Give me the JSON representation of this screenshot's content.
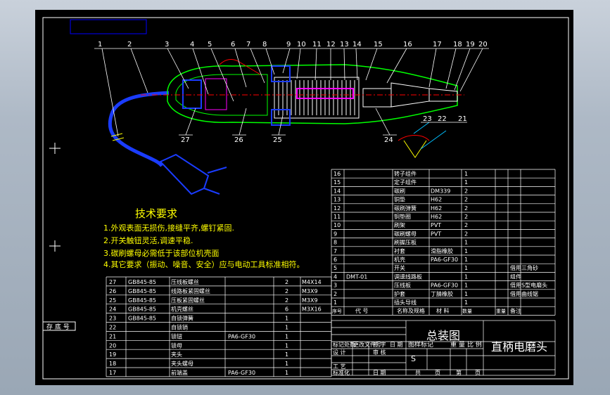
{
  "drawing": {
    "title": "直柄电磨头",
    "subtitle": "总装图",
    "stamp_label": "存 底 号"
  },
  "callouts_top": [
    "1",
    "2",
    "3",
    "4",
    "5",
    "6",
    "7",
    "8",
    "9",
    "10",
    "11",
    "12",
    "13",
    "14",
    "15",
    "16",
    "17",
    "18",
    "19",
    "20"
  ],
  "callouts_bottom": [
    "27",
    "26",
    "25",
    "24",
    "23",
    "22",
    "21"
  ],
  "requirements": {
    "heading": "技术要求",
    "items": [
      "1.外观表面无损伤,接缝平齐,螺钉紧固.",
      "2.开关触钮灵活,调速平稳.",
      "3.碳刷螺母必需低于该部位机壳面",
      "4.其它要求（振动、噪音、安全）应与电动工具标准相符。"
    ]
  },
  "bom_right": {
    "rows": [
      {
        "no": "16",
        "code": "",
        "name": "转子组件",
        "material": "",
        "qty": "1",
        "note": ""
      },
      {
        "no": "15",
        "code": "",
        "name": "定子组件",
        "material": "",
        "qty": "1",
        "note": ""
      },
      {
        "no": "14",
        "code": "",
        "name": "碳刷",
        "material": "DM339",
        "qty": "2",
        "note": ""
      },
      {
        "no": "13",
        "code": "",
        "name": "铜垫",
        "material": "H62",
        "qty": "2",
        "note": ""
      },
      {
        "no": "12",
        "code": "",
        "name": "碳刷弹簧",
        "material": "H62",
        "qty": "2",
        "note": ""
      },
      {
        "no": "11",
        "code": "",
        "name": "铜垫圈",
        "material": "H62",
        "qty": "2",
        "note": ""
      },
      {
        "no": "10",
        "code": "",
        "name": "刷架",
        "material": "PVT",
        "qty": "2",
        "note": ""
      },
      {
        "no": "9",
        "code": "",
        "name": "碳刷螺母",
        "material": "PVT",
        "qty": "2",
        "note": ""
      },
      {
        "no": "8",
        "code": "",
        "name": "刷握压板",
        "material": "",
        "qty": "1",
        "note": ""
      },
      {
        "no": "7",
        "code": "",
        "name": "衬套",
        "material": "滑脂橡胶",
        "qty": "1",
        "note": ""
      },
      {
        "no": "6",
        "code": "",
        "name": "机壳",
        "material": "PA6-GF30",
        "qty": "1",
        "note": ""
      },
      {
        "no": "5",
        "code": "",
        "name": "开关",
        "material": "",
        "qty": "1",
        "note": "借用三角砂"
      },
      {
        "no": "4",
        "code": "DMT-01",
        "name": "调速线路板",
        "material": "",
        "qty": "1",
        "note": "组件"
      },
      {
        "no": "3",
        "code": "",
        "name": "压线板",
        "material": "PA6-GF30",
        "qty": "1",
        "note": "借用S型电磨头"
      },
      {
        "no": "2",
        "code": "",
        "name": "护套",
        "material": "丁腈橡胶",
        "qty": "1",
        "note": "借用曲线锯"
      },
      {
        "no": "1",
        "code": "",
        "name": "插头导线",
        "material": "",
        "qty": "1",
        "note": ""
      }
    ],
    "header": {
      "no": "序号",
      "code": "代 号",
      "name": "名称及规格",
      "material": "材 料",
      "qty": "数量",
      "weight": "重量",
      "note": "备注"
    }
  },
  "bom_left": {
    "rows": [
      {
        "no": "27",
        "code": "GB845-85",
        "name": "压线板螺丝",
        "material": "",
        "qty": "2",
        "spec": "M4X14"
      },
      {
        "no": "26",
        "code": "GB845-85",
        "name": "线路板紧固螺丝",
        "material": "",
        "qty": "2",
        "spec": "M3X9"
      },
      {
        "no": "25",
        "code": "GB845-85",
        "name": "压板紧固螺丝",
        "material": "",
        "qty": "2",
        "spec": "M3X9"
      },
      {
        "no": "24",
        "code": "GB845-85",
        "name": "机壳螺丝",
        "material": "",
        "qty": "6",
        "spec": "M3X16"
      },
      {
        "no": "23",
        "code": "GB845-85",
        "name": "自锁弹簧",
        "material": "",
        "qty": "1",
        "spec": ""
      },
      {
        "no": "22",
        "code": "",
        "name": "自锁销",
        "material": "",
        "qty": "1",
        "spec": ""
      },
      {
        "no": "21",
        "code": "",
        "name": "锁钮",
        "material": "PA6-GF30",
        "qty": "1",
        "spec": ""
      },
      {
        "no": "20",
        "code": "",
        "name": "锁母",
        "material": "",
        "qty": "1",
        "spec": ""
      },
      {
        "no": "19",
        "code": "",
        "name": "夹头",
        "material": "",
        "qty": "1",
        "spec": ""
      },
      {
        "no": "18",
        "code": "",
        "name": "夹头螺母",
        "material": "",
        "qty": "1",
        "spec": ""
      },
      {
        "no": "17",
        "code": "",
        "name": "前端盖",
        "material": "PA6-GF30",
        "qty": "1",
        "spec": ""
      }
    ]
  },
  "title_block": {
    "labels": [
      "标记处数",
      "更改文件号",
      "签 字",
      "日 期",
      "设 计",
      "审 核",
      "工 艺",
      "标准化",
      "日 期",
      "图样标记",
      "重 量",
      "比 例",
      "共",
      "页",
      "第",
      "页"
    ],
    "scale_mark": "S"
  },
  "colors": {
    "sheet": "#000000",
    "frame": "#ffffff",
    "lines": "#ffff00",
    "housing": "#00ff00",
    "motor": "#ffffff",
    "accent": "#ff0000",
    "cable": "#1a3cff",
    "leader": "#00bfff"
  }
}
